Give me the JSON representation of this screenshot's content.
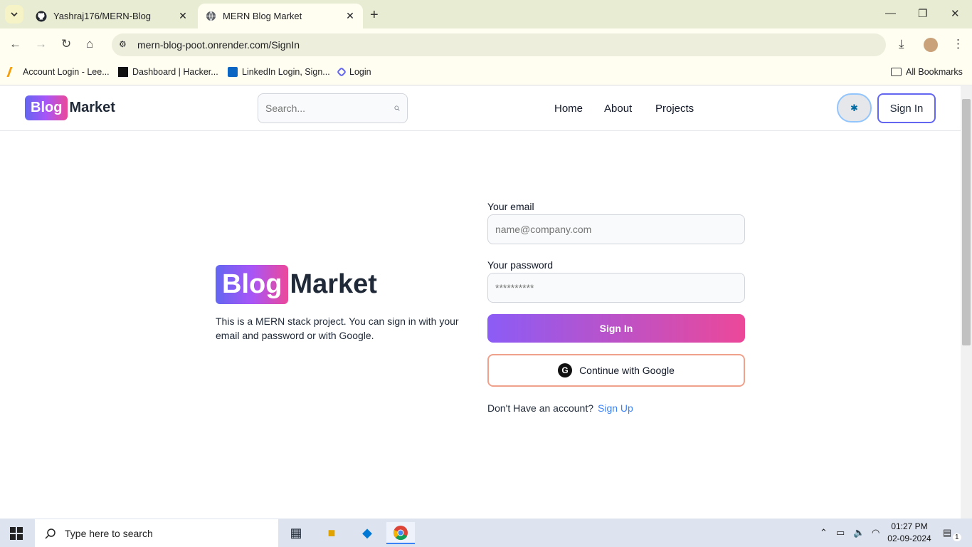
{
  "browser": {
    "tabs": [
      {
        "title": "Yashraj176/MERN-Blog",
        "active": false
      },
      {
        "title": "MERN Blog Market",
        "active": true
      }
    ],
    "url": "mern-blog-poot.onrender.com/SignIn",
    "bookmarks": [
      "Account Login - Lee...",
      "Dashboard | Hacker...",
      "LinkedIn Login, Sign...",
      "Login"
    ],
    "all_bookmarks": "All Bookmarks"
  },
  "header": {
    "logo_pill": "Blog",
    "logo_rest": "Market",
    "search_placeholder": "Search...",
    "nav": [
      "Home",
      "About",
      "Projects"
    ],
    "signin_label": "Sign In"
  },
  "hero": {
    "logo_pill": "Blog",
    "logo_rest": "Market",
    "description": "This is a MERN stack project. You can sign in with your email and password or with Google."
  },
  "form": {
    "email_label": "Your email",
    "email_placeholder": "name@company.com",
    "password_label": "Your password",
    "password_placeholder": "**********",
    "signin_button": "Sign In",
    "google_button": "Continue with Google",
    "no_account_text": "Don't Have an account?",
    "signup_link": "Sign Up"
  },
  "taskbar": {
    "search_placeholder": "Type here to search",
    "time": "01:27 PM",
    "date": "02-09-2024",
    "notification_count": "1"
  },
  "colors": {
    "accent_gradient_start": "#8b5cf6",
    "accent_gradient_end": "#ec4899",
    "link": "#3b82f6"
  }
}
